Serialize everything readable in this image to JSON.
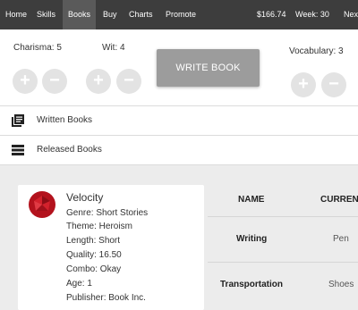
{
  "nav": {
    "home": "Home",
    "skills": "Skills",
    "books": "Books",
    "buy": "Buy",
    "charts": "Charts",
    "promote": "Promote",
    "money": "$166.74",
    "week": "Week: 30",
    "next": "Next"
  },
  "stats": {
    "charisma": "Charisma: 5",
    "wit": "Wit: 4",
    "vocabulary": "Vocabulary: 3",
    "plus": "+",
    "minus": "−",
    "write_book": "WRITE BOOK"
  },
  "sections": {
    "written": "Written Books",
    "released": "Released Books"
  },
  "book": {
    "title": "Velocity",
    "genre": "Genre: Short Stories",
    "theme": "Theme: Heroism",
    "length": "Length: Short",
    "quality": "Quality: 16.50",
    "combo": "Combo: Okay",
    "age": "Age: 1",
    "publisher": "Publisher: Book Inc.",
    "avatar_color": "#b3121d"
  },
  "table": {
    "headers": {
      "name": "NAME",
      "current": "CURRENT"
    },
    "rows": [
      {
        "name": "Writing",
        "current": "Pen"
      },
      {
        "name": "Transportation",
        "current": "Shoes"
      }
    ]
  }
}
